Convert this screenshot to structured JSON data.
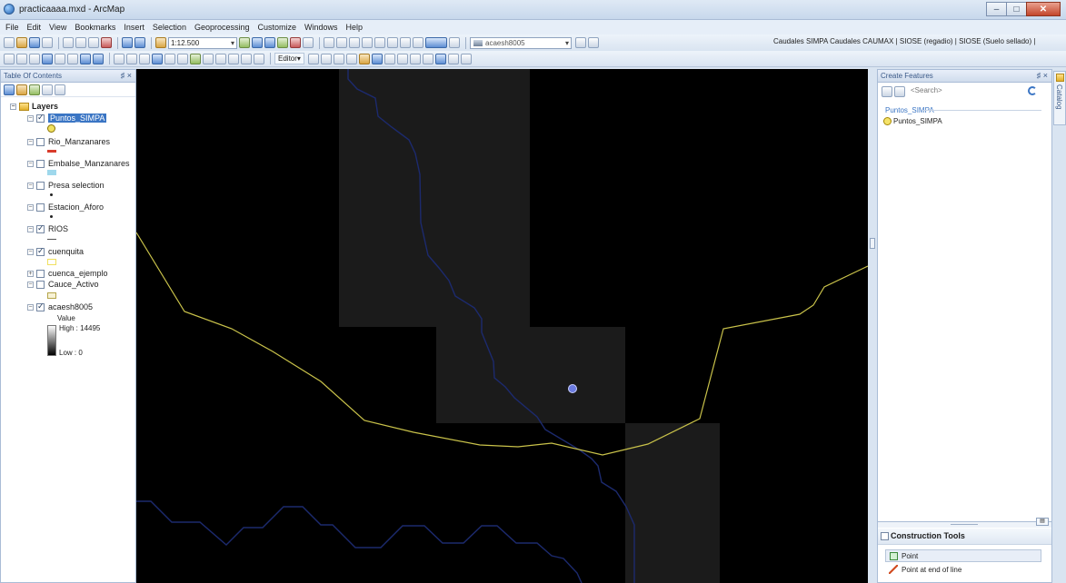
{
  "window": {
    "title": "practicaaaa.mxd - ArcMap"
  },
  "menu": [
    "File",
    "Edit",
    "View",
    "Bookmarks",
    "Insert",
    "Selection",
    "Geoprocessing",
    "Customize",
    "Windows",
    "Help"
  ],
  "toolbar": {
    "scale": "1:12.500",
    "layer_combo": "acaesh8005",
    "editor_label": "Editor▾",
    "basemap_links": "Caudales SIMPA  Caudales CAUMAX |  SIOSE (regadio) |  SIOSE (Suelo sellado) |"
  },
  "toc": {
    "title": "Table Of Contents",
    "pin": "♯ ×",
    "root": "Layers",
    "layers": [
      {
        "name": "Puntos_SIMPA",
        "checked": true,
        "selected": true
      },
      {
        "name": "Rio_Manzanares",
        "checked": false
      },
      {
        "name": "Embalse_Manzanares",
        "checked": false
      },
      {
        "name": "Presa selection",
        "checked": false
      },
      {
        "name": "Estacion_Aforo",
        "checked": false
      },
      {
        "name": "RIOS",
        "checked": true
      },
      {
        "name": "cuenquita",
        "checked": true
      },
      {
        "name": "cuenca_ejemplo",
        "checked": false
      },
      {
        "name": "Cauce_Activo",
        "checked": false
      },
      {
        "name": "acaesh8005",
        "checked": true
      }
    ],
    "raster_legend": {
      "title": "Value",
      "high": "High : 14495",
      "low": "Low : 0"
    },
    "colors": {
      "river_red": "#d93c2c",
      "reservoir": "#9fd8ec",
      "basin_yellow": "#f0e060",
      "active_channel": "#b5a54a"
    }
  },
  "map": {
    "colors": {
      "background": "#000000",
      "raster_cell": "#1b1b1b",
      "basin_line": "#c9c24a",
      "river_line": "#1c2a6e",
      "point_fill": "#6b7be0"
    }
  },
  "create_features": {
    "title": "Create Features",
    "pin": "♯ ×",
    "search_placeholder": "<Search>",
    "group": "Puntos_SIMPA",
    "template": "Puntos_SIMPA"
  },
  "construction_tools": {
    "title": "Construction Tools",
    "items": [
      "Point",
      "Point at end of line"
    ]
  },
  "catalog_tab": "Catalog"
}
